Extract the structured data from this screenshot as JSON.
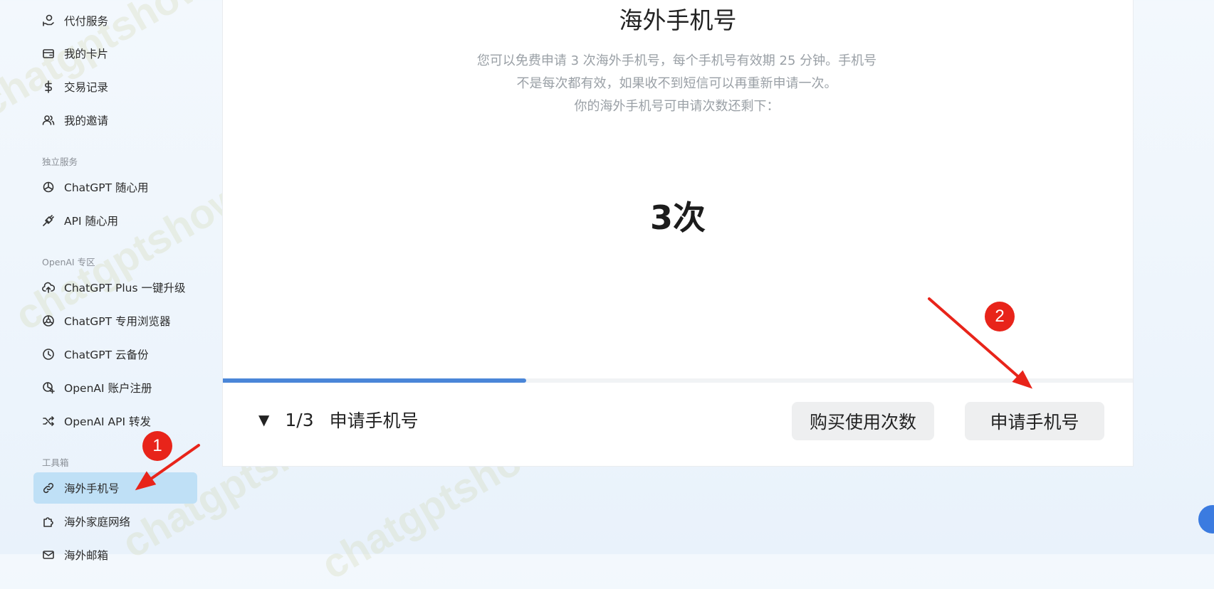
{
  "sidebar": {
    "items_top": [
      {
        "label": "代付服务",
        "icon": "payment-hand-icon"
      },
      {
        "label": "我的卡片",
        "icon": "card-icon"
      },
      {
        "label": "交易记录",
        "icon": "dollar-icon"
      },
      {
        "label": "我的邀请",
        "icon": "users-icon"
      }
    ],
    "section_independent": "独立服务",
    "items_independent": [
      {
        "label": "ChatGPT 随心用",
        "icon": "openai-icon"
      },
      {
        "label": "API 随心用",
        "icon": "plug-icon"
      }
    ],
    "section_openai": "OpenAI 专区",
    "items_openai": [
      {
        "label": "ChatGPT Plus 一键升级",
        "icon": "cloud-upload-icon"
      },
      {
        "label": "ChatGPT 专用浏览器",
        "icon": "browser-icon"
      },
      {
        "label": "ChatGPT 云备份",
        "icon": "clock-icon"
      },
      {
        "label": "OpenAI 账户注册",
        "icon": "openai-register-icon"
      },
      {
        "label": "OpenAI API 转发",
        "icon": "shuffle-icon"
      }
    ],
    "section_tools": "工具箱",
    "items_tools": [
      {
        "label": "海外手机号",
        "icon": "link-icon",
        "active": true
      },
      {
        "label": "海外家庭网络",
        "icon": "puzzle-icon"
      },
      {
        "label": "海外邮箱",
        "icon": "mail-icon"
      }
    ]
  },
  "main": {
    "title": "海外手机号",
    "description_line1": "您可以免费申请 3 次海外手机号，每个手机号有效期 25 分钟。手机号",
    "description_line2": "不是每次都有效，如果收不到短信可以再重新申请一次。",
    "description_line3": "你的海外手机号可申请次数还剩下：",
    "remaining_count": "3次",
    "progress_fraction": 0.333,
    "step_indicator": "1/3",
    "step_label": "申请手机号",
    "buy_button": "购买使用次数",
    "apply_button": "申请手机号"
  },
  "annotations": {
    "badge_1": "1",
    "badge_2": "2",
    "arrow_color": "#e8241a"
  },
  "watermark": "chatgptshow.com",
  "colors": {
    "accent": "#4a86d8",
    "active_nav_bg": "#bfe0f6"
  }
}
